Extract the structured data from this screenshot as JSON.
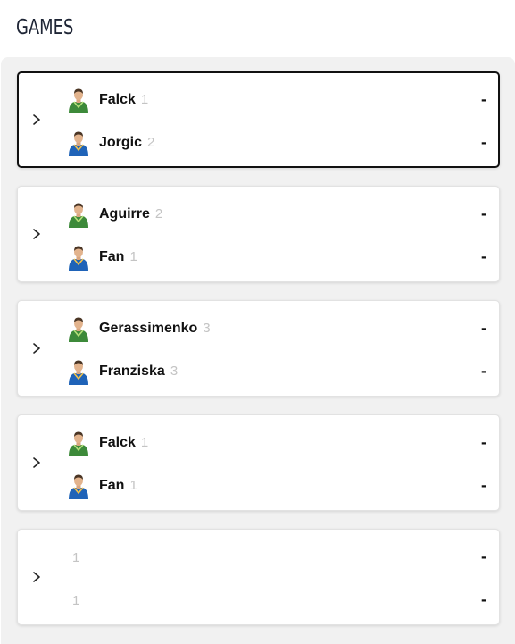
{
  "title": "GAMES",
  "games": [
    {
      "active": true,
      "home": {
        "name": "Falck",
        "seed": "1",
        "score": "-",
        "team": "green"
      },
      "away": {
        "name": "Jorgic",
        "seed": "2",
        "score": "-",
        "team": "blue"
      }
    },
    {
      "active": false,
      "home": {
        "name": "Aguirre",
        "seed": "2",
        "score": "-",
        "team": "green"
      },
      "away": {
        "name": "Fan",
        "seed": "1",
        "score": "-",
        "team": "blue"
      }
    },
    {
      "active": false,
      "home": {
        "name": "Gerassimenko",
        "seed": "3",
        "score": "-",
        "team": "green"
      },
      "away": {
        "name": "Franziska",
        "seed": "3",
        "score": "-",
        "team": "blue"
      }
    },
    {
      "active": false,
      "home": {
        "name": "Falck",
        "seed": "1",
        "score": "-",
        "team": "green"
      },
      "away": {
        "name": "Fan",
        "seed": "1",
        "score": "-",
        "team": "blue"
      }
    },
    {
      "active": false,
      "home": {
        "name": "",
        "seed": "1",
        "score": "-",
        "team": ""
      },
      "away": {
        "name": "",
        "seed": "1",
        "score": "-",
        "team": ""
      }
    }
  ],
  "colors": {
    "green_jersey": "#3d8a3a",
    "blue_jersey": "#1f63b8",
    "active_border": "#111111",
    "panel_bg": "#f1f1f1"
  },
  "icons": {
    "expand": "chevron-right-icon",
    "player": "player-avatar-icon"
  }
}
